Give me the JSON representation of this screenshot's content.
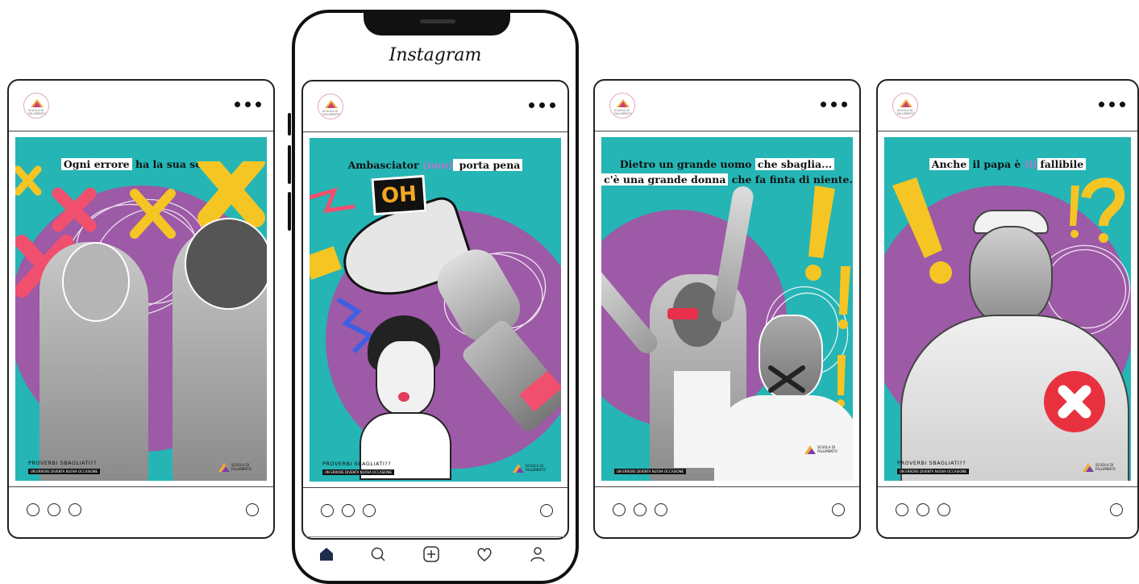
{
  "app": {
    "title": "Instagram"
  },
  "posts": [
    {
      "caption_parts": [
        {
          "text": "Ogni errore",
          "style": "highlight"
        },
        {
          "text": " ha la sua scusa",
          "style": "plain"
        }
      ],
      "footer_left_1": "PROVERBI SBAGLIATI??",
      "footer_left_2": "UN ERRORE DIVENTA NUOVA OCCASIONE",
      "footer_right": "SCUOLA DI FALLIMENTO"
    },
    {
      "caption_parts": [
        {
          "text": "Ambasciator ",
          "style": "plain"
        },
        {
          "text": "(non)",
          "style": "purple"
        },
        {
          "text": " porta pena",
          "style": "highlight"
        }
      ],
      "bubble": "OH",
      "footer_left_1": "PROVERBI SBAGLIATI??",
      "footer_left_2": "UN ERRORE DIVENTA NUOVA OCCASIONE",
      "footer_right": "SCUOLA DI FALLIMENTO"
    },
    {
      "caption_line1": [
        {
          "text": "Dietro un grande uomo ",
          "style": "plain"
        },
        {
          "text": "che sbaglia...",
          "style": "highlight"
        }
      ],
      "caption_line2": [
        {
          "text": "c'è una grande donna",
          "style": "highlight"
        },
        {
          "text": " che fa finta di niente.",
          "style": "plain"
        }
      ],
      "footer_left_2": "UN ERRORE DIVENTA NUOVA OCCASIONE",
      "footer_right": "SCUOLA DI FALLIMENTO"
    },
    {
      "caption_parts": [
        {
          "text": "Anche",
          "style": "highlight"
        },
        {
          "text": " il papa è ",
          "style": "plain"
        },
        {
          "text": "(i)",
          "style": "purple"
        },
        {
          "text": "fallibile",
          "style": "highlight"
        }
      ],
      "footer_left_1": "PROVERBI SBAGLIATI??",
      "footer_left_2": "UN ERRORE DIVENTA NUOVA OCCASIONE",
      "footer_right": "SCUOLA DI FALLIMENTO"
    }
  ],
  "logo_text": "SCUOLA DI FALLIMENTO",
  "colors": {
    "teal": "#25b5b5",
    "purple": "#9d5aa6",
    "yellow": "#f5c524",
    "pink": "#f0506e"
  },
  "nav": [
    "home-icon",
    "search-icon",
    "add-icon",
    "heart-icon",
    "profile-icon"
  ]
}
